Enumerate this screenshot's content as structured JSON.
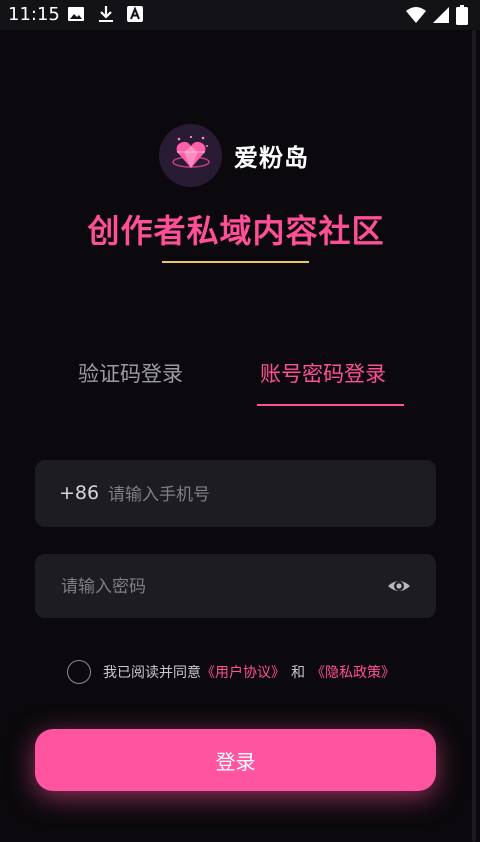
{
  "status_bar": {
    "time": "11:15",
    "left_icons": [
      "image-icon",
      "download-icon",
      "a-icon"
    ],
    "right_icons": [
      "wifi-icon",
      "signal-icon",
      "battery-icon"
    ]
  },
  "brand": {
    "app_name": "爱粉岛",
    "logo_icon": "heart-gem-icon"
  },
  "headline": "创作者私域内容社区",
  "tabs": [
    {
      "label": "验证码登录",
      "active": false
    },
    {
      "label": "账号密码登录",
      "active": true
    }
  ],
  "phone_field": {
    "country_code": "+86",
    "placeholder": "请输入手机号",
    "value": ""
  },
  "password_field": {
    "placeholder": "请输入密码",
    "value": "",
    "toggle_icon": "eye-icon"
  },
  "agreement": {
    "checked": false,
    "prefix": "我已阅读并同意",
    "user_agreement": "《用户协议》",
    "conjunction": "和",
    "privacy_policy": "《隐私政策》"
  },
  "login_button": "登录",
  "colors": {
    "background": "#0b090d",
    "accent": "#ff4f97",
    "underline_gold": "#e8c86b",
    "field_bg": "#1d1c21"
  }
}
